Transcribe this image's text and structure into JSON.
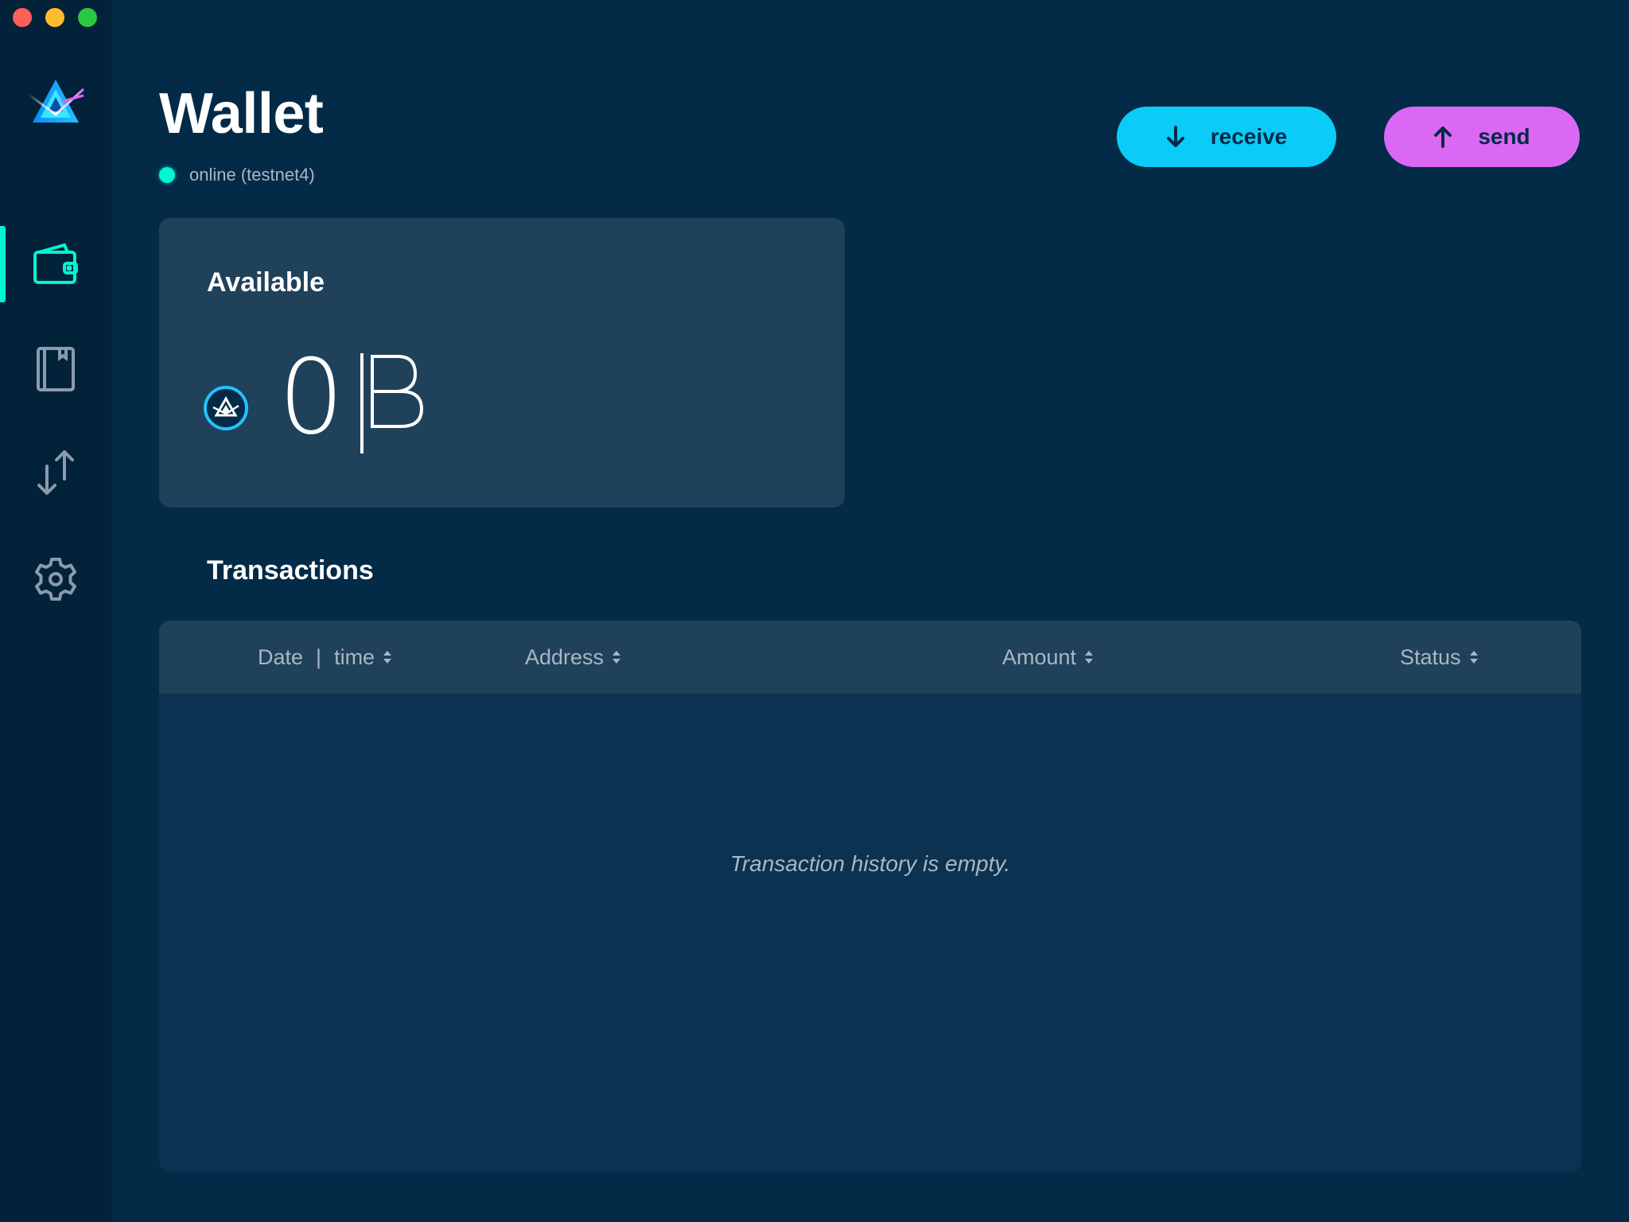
{
  "window": {
    "controls": [
      "close",
      "minimize",
      "maximize"
    ]
  },
  "sidebar": {
    "logo": "beam-logo",
    "items": [
      {
        "id": "wallet",
        "icon": "wallet-icon",
        "active": true
      },
      {
        "id": "addresses",
        "icon": "address-book-icon",
        "active": false
      },
      {
        "id": "utxo",
        "icon": "transfer-arrows-icon",
        "active": false
      },
      {
        "id": "settings",
        "icon": "gear-icon",
        "active": false
      }
    ],
    "accent_color": "#00f6d2"
  },
  "header": {
    "title": "Wallet",
    "status_text": "online (testnet4)",
    "status_color": "#00f6d2"
  },
  "actions": {
    "receive_label": "receive",
    "receive_color": "#0bccf7",
    "send_label": "send",
    "send_color": "#da68f5"
  },
  "balance": {
    "title": "Available",
    "amount": "0",
    "currency_symbol": "beam-symbol-icon"
  },
  "transactions": {
    "title": "Transactions",
    "columns": {
      "date": "Date",
      "date_sep": "|",
      "time": "time",
      "address": "Address",
      "amount": "Amount",
      "status": "Status"
    },
    "empty_text": "Transaction history is empty."
  }
}
